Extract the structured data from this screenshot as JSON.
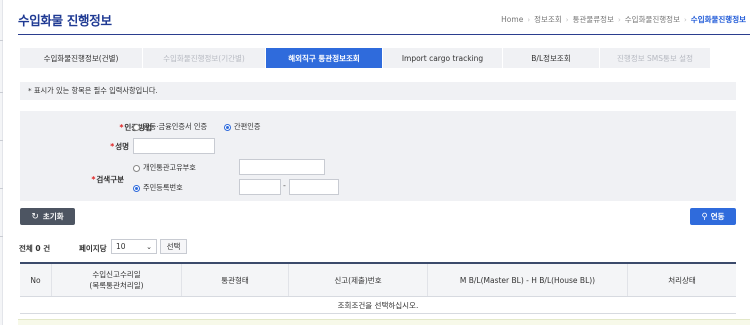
{
  "header": {
    "title": "수입화물 진행정보",
    "breadcrumb": [
      "Home",
      "정보조회",
      "통관물류정보",
      "수입화물진행정보",
      "수입화물진행정보"
    ]
  },
  "tabs": [
    {
      "label": "수입화물진행정보(건별)",
      "state": "normal"
    },
    {
      "label": "수입화물진행정보(기간별)",
      "state": "disabled"
    },
    {
      "label": "해외직구 통관정보조회",
      "state": "active"
    },
    {
      "label": "Import cargo tracking",
      "state": "normal"
    },
    {
      "label": "B/L정보조회",
      "state": "normal"
    },
    {
      "label": "진행정보 SMS통보 설정",
      "state": "disabled"
    }
  ],
  "notice": "* 표시가 있는 항목은 필수 입력사항입니다.",
  "form": {
    "auth_method": {
      "required_mark": "*",
      "label": "인증방법",
      "options": [
        {
          "label": "공동·금융인증서 인증",
          "selected": false
        },
        {
          "label": "간편인증",
          "selected": true
        }
      ]
    },
    "name": {
      "required_mark": "*",
      "label": "성명",
      "value": ""
    },
    "search_type": {
      "required_mark": "*",
      "label": "검색구분",
      "options": [
        {
          "label": "개인통관고유부호",
          "selected": false
        },
        {
          "label": "주민등록번호",
          "selected": true
        }
      ],
      "customs_code_value": "",
      "rrn_front_value": "",
      "rrn_separator": "-",
      "rrn_back_value": ""
    }
  },
  "actions": {
    "reset_label": "초기화",
    "reset_icon": "refresh-icon",
    "search_label": "연동",
    "search_icon": "search-icon"
  },
  "list": {
    "total_text": "전체 0 건",
    "per_page_label": "페이지당",
    "per_page_value": "10",
    "select_button_label": "선택"
  },
  "table": {
    "columns": [
      {
        "line1": "No",
        "line2": ""
      },
      {
        "line1": "수입신고수리일",
        "line2": "(목록통관처리일)"
      },
      {
        "line1": "통관형태",
        "line2": ""
      },
      {
        "line1": "신고(제출)번호",
        "line2": ""
      },
      {
        "line1": "M B/L(Master BL) - H B/L(House BL))",
        "line2": ""
      },
      {
        "line1": "처리상태",
        "line2": ""
      }
    ],
    "empty_message": "조회조건을 선택하십시오."
  },
  "colors": {
    "primary": "#2f6bdc",
    "title": "#1f3a93",
    "reset_button": "#4d5562",
    "required": "#e02020"
  }
}
